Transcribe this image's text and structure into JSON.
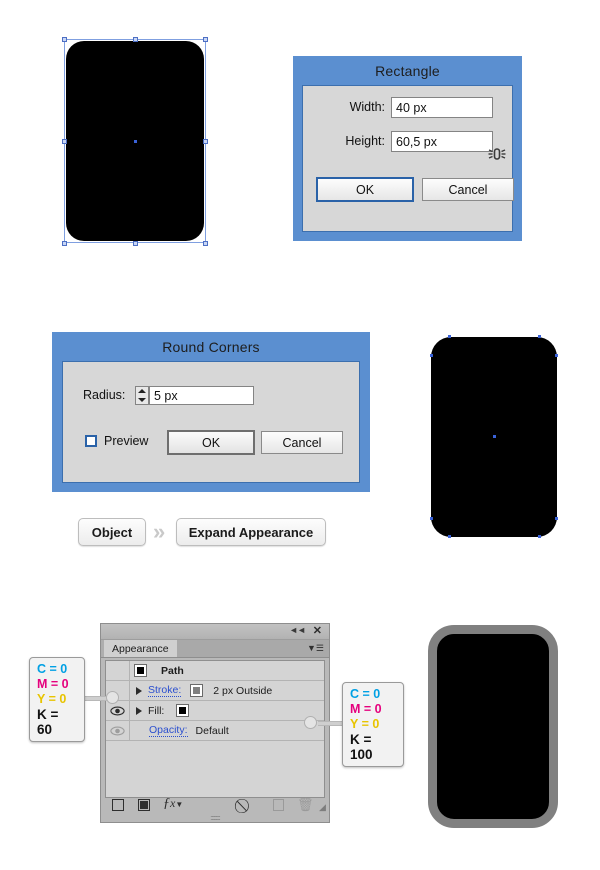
{
  "artwork": {
    "rect_top_left": {
      "label": "rounded-rectangle-selected"
    },
    "rect_mid_right": {
      "label": "rounded-rectangle-anchors"
    },
    "rect_bot_right": {
      "label": "rounded-rectangle-stroked"
    }
  },
  "rectangle_dialog": {
    "title": "Rectangle",
    "width_label": "Width:",
    "width_value": "40 px",
    "height_label": "Height:",
    "height_value": "60,5 px",
    "constrain_icon": "constrain-proportions-icon",
    "ok_label": "OK",
    "cancel_label": "Cancel"
  },
  "round_corners_dialog": {
    "title": "Round Corners",
    "radius_label": "Radius:",
    "radius_value": "5 px",
    "preview_label": "Preview",
    "preview_checked": false,
    "ok_label": "OK",
    "cancel_label": "Cancel"
  },
  "menu_path": {
    "object_label": "Object",
    "separator_icon": "chevron-right-icon",
    "expand_label": "Expand Appearance"
  },
  "appearance_panel": {
    "collapse_icon": "collapse-panel-icon",
    "close_icon": "close-icon",
    "menu_icon": "panel-menu-icon",
    "tab_label": "Appearance",
    "rows": [
      {
        "name": "Path",
        "type": "header",
        "swatch": "black",
        "eye": "none",
        "value": ""
      },
      {
        "name": "Stroke:",
        "type": "link",
        "swatch": "gray",
        "eye": "hidden",
        "value": "2 px  Outside"
      },
      {
        "name": "Fill:",
        "type": "plain",
        "swatch": "black",
        "eye": "visible",
        "value": ""
      },
      {
        "name": "Opacity:",
        "type": "link",
        "swatch": "none",
        "eye": "dim",
        "value": "Default"
      }
    ],
    "footer_icons": [
      {
        "name": "new-fill-icon"
      },
      {
        "name": "new-stroke-icon"
      },
      {
        "name": "add-effect-fx-icon"
      },
      {
        "name": "clear-appearance-icon"
      },
      {
        "name": "duplicate-item-icon"
      },
      {
        "name": "delete-item-icon"
      },
      {
        "name": "resize-grip-icon"
      }
    ]
  },
  "callout_stroke_color": {
    "c": "C = 0",
    "m": "M = 0",
    "y": "Y = 0",
    "k": "K = 60"
  },
  "callout_fill_color": {
    "c": "C = 0",
    "m": "M = 0",
    "y": "Y = 0",
    "k": "K = 100"
  },
  "colors": {
    "dialog_blue": "#5b8fd0",
    "dialog_face": "#d7d7d7",
    "panel_gray": "#b9b9b9",
    "stroke_gray": "#808080",
    "fill_black": "#000000",
    "link_blue": "#2b4fcf",
    "cyan": "#00a0e4",
    "magenta": "#e5007d",
    "yellow": "#e8c400"
  }
}
